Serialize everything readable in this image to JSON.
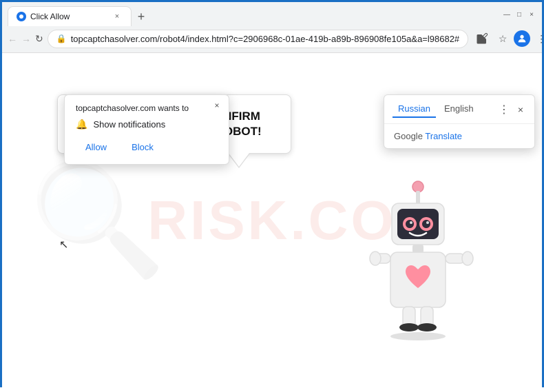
{
  "browser": {
    "tab": {
      "title": "Click Allow",
      "close_label": "×"
    },
    "new_tab_label": "+",
    "window_controls": {
      "minimize": "—",
      "maximize": "□",
      "close": "×"
    },
    "url": "topcaptchasolver.com/robot4/index.html?c=2906968c-01ae-419b-a89b-896908fe105a&a=l98682#",
    "url_display": "topcaptchasolver.com/robot4/index.html?c=2906968c-01ae-419b-a89b-896908fe105a&a=l98682#"
  },
  "notification_popup": {
    "site": "topcaptchasolver.com wants to",
    "notification_label": "Show notifications",
    "allow_button": "Allow",
    "block_button": "Block",
    "close": "×"
  },
  "translate_popup": {
    "tab_russian": "Russian",
    "tab_english": "English",
    "google_label": "Google",
    "translate_label": "Translate",
    "close": "×",
    "menu": "⋮"
  },
  "page": {
    "message": "CLICK «ALLOW» TO CONFIRM THAT YOU ARE NOT A ROBOT!",
    "watermark": "RISK.CO",
    "accent_color": "#1a73e8"
  }
}
